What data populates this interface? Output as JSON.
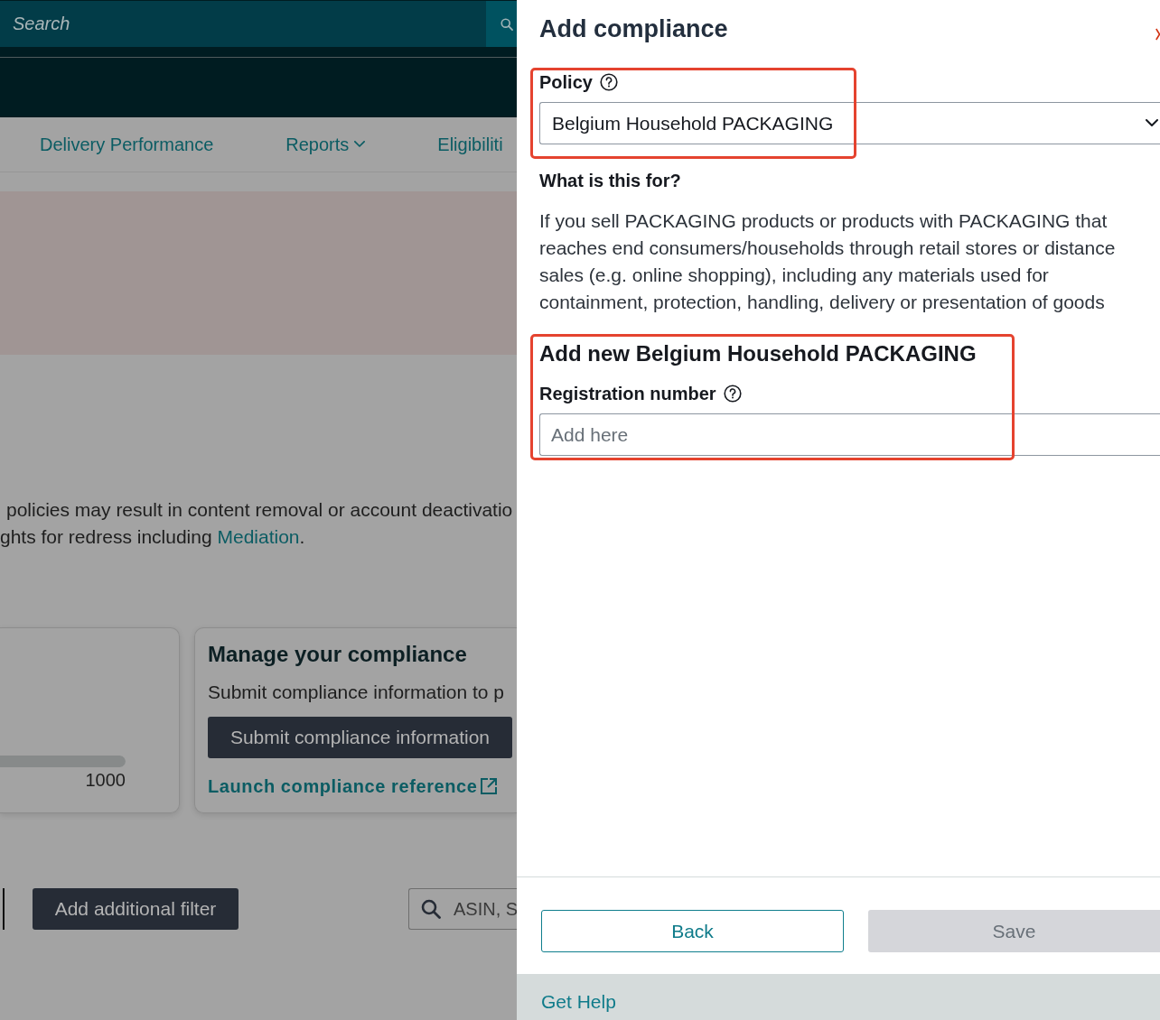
{
  "background_page": {
    "search": {
      "placeholder": "Search"
    },
    "nav": [
      {
        "label": "Delivery Performance",
        "kind": "link"
      },
      {
        "label": "Reports",
        "kind": "dropdown"
      },
      {
        "label": "Eligibiliti",
        "kind": "link"
      }
    ],
    "notice_lines": [
      {
        "text": "policies may result in content removal or account deactivatio"
      },
      {
        "text": "ghts for redress including ",
        "link": "Mediation",
        "after": "."
      }
    ],
    "progress_card": {
      "level": 1,
      "max_label": "1000"
    },
    "compliance_card": {
      "title": "Manage your compliance",
      "text": "Submit compliance information to p",
      "button": "Submit compliance information",
      "link": "Launch compliance reference"
    },
    "filter_button": "Add additional filter",
    "product_search": {
      "placeholder": "ASIN, S"
    }
  },
  "panel": {
    "title": "Add compliance",
    "policy": {
      "label": "Policy",
      "value": "Belgium Household PACKAGING",
      "highlighted": true
    },
    "info": {
      "heading": "What is this for?",
      "text": "If you sell PACKAGING products or products with PACKAGING that reaches end consumers/households through retail stores or distance sales (e.g. online shopping), including any materials used for containment, protection, handling, delivery or presentation of goods"
    },
    "registration": {
      "heading": "Add new Belgium Household PACKAGING",
      "label": "Registration number",
      "placeholder": "Add here",
      "highlighted": true
    },
    "buttons": [
      {
        "label": "Back",
        "disabled": false
      },
      {
        "label": "Save",
        "disabled": true
      }
    ],
    "help_link": "Get Help"
  }
}
